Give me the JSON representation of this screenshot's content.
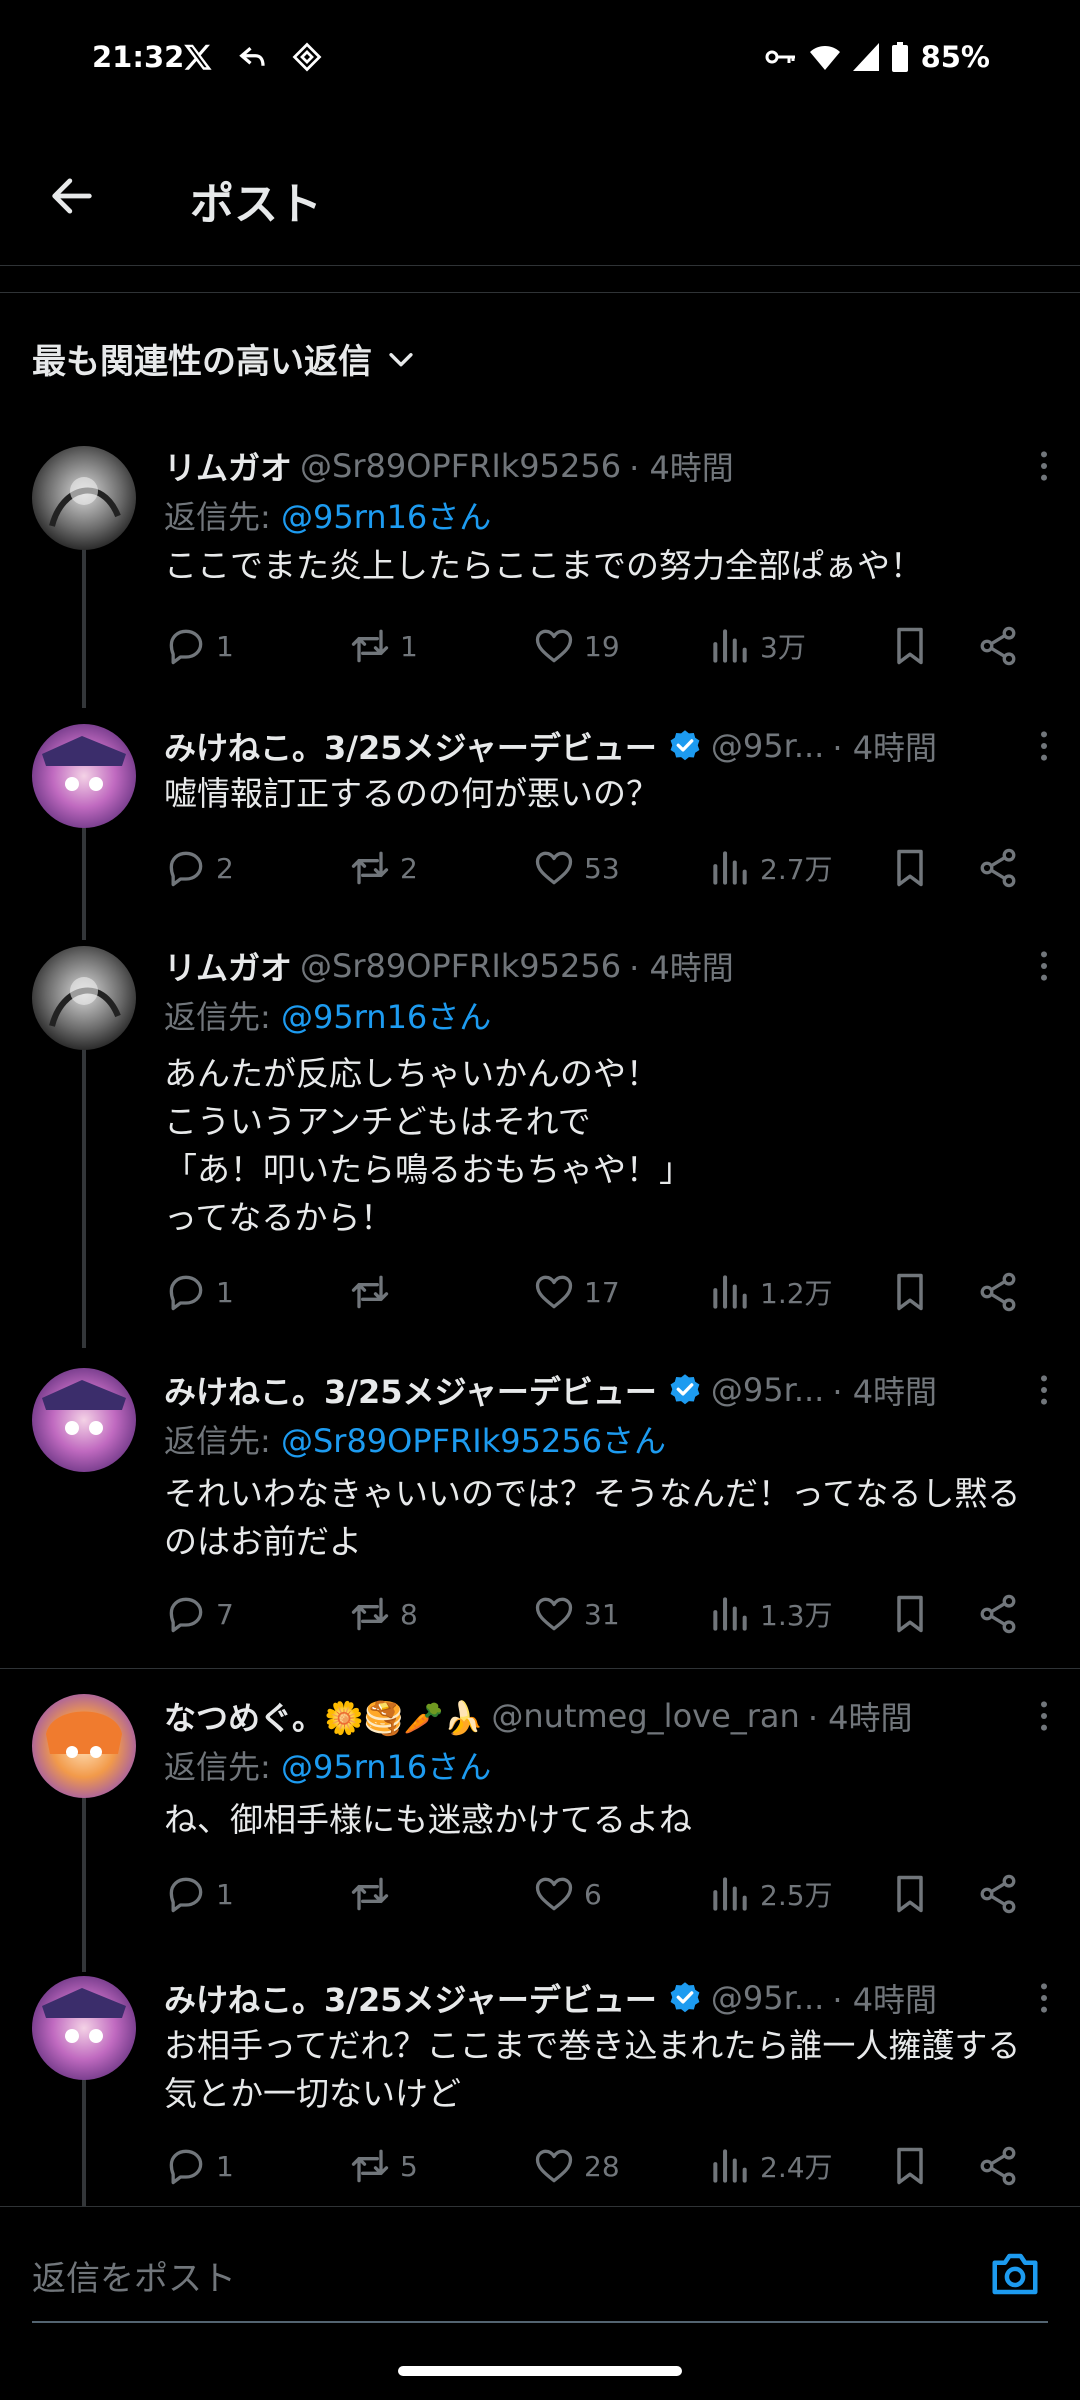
{
  "status_bar": {
    "time": "21:32",
    "battery": "85%",
    "icons": [
      "x-logo-icon",
      "reply-arrow-icon",
      "diamond-icon",
      "key-icon",
      "wifi-icon",
      "signal-icon",
      "battery-icon"
    ]
  },
  "header": {
    "title": "ポスト"
  },
  "sort": {
    "label": "最も関連性の高い返信"
  },
  "posts": [
    {
      "name": "リムガオ",
      "handle": "@Sr89OPFRIk95256",
      "time": "· 4時間",
      "reply_prefix": "返信先: ",
      "reply_to": "@95rn16さん",
      "text": "ここでまた炎上したらここまでの努力全部ぱぁや！",
      "replies": "1",
      "reposts": "1",
      "likes": "19",
      "views": "3万"
    },
    {
      "name": "みけねこ。3/25メジャーデビュー",
      "handle": "@95r...",
      "time": "· 4時間",
      "text": "嘘情報訂正するのの何が悪いの？",
      "replies": "2",
      "reposts": "2",
      "likes": "53",
      "views": "2.7万"
    },
    {
      "name": "リムガオ",
      "handle": "@Sr89OPFRIk95256",
      "time": "· 4時間",
      "reply_prefix": "返信先: ",
      "reply_to": "@95rn16さん",
      "text": "あんたが反応しちゃいかんのや！\nこういうアンチどもはそれで\n「あ！叩いたら鳴るおもちゃや！」\nってなるから！",
      "replies": "1",
      "reposts": "",
      "likes": "17",
      "views": "1.2万"
    },
    {
      "name": "みけねこ。3/25メジャーデビュー",
      "handle": "@95r...",
      "time": "· 4時間",
      "reply_prefix": "返信先: ",
      "reply_to": "@Sr89OPFRIk95256さん",
      "text": "それいわなきゃいいのでは？そうなんだ！ってなるし黙るのはお前だよ",
      "replies": "7",
      "reposts": "8",
      "likes": "31",
      "views": "1.3万"
    },
    {
      "name": "なつめぐ。🌼🥞🥕🍌",
      "handle": "@nutmeg_love_ran",
      "time": "· 4時間",
      "reply_prefix": "返信先: ",
      "reply_to": "@95rn16さん",
      "text": "ね、御相手様にも迷惑かけてるよね",
      "replies": "1",
      "reposts": "",
      "likes": "6",
      "views": "2.5万"
    },
    {
      "name": "みけねこ。3/25メジャーデビュー",
      "handle": "@95r...",
      "time": "· 4時間",
      "text": "お相手ってだれ？ここまで巻き込まれたら誰一人擁護する気とか一切ないけど",
      "replies": "1",
      "reposts": "5",
      "likes": "28",
      "views": "2.4万"
    }
  ],
  "reply_bar": {
    "placeholder": "返信をポスト"
  },
  "colors": {
    "accent": "#1d9bf0",
    "muted": "#71767b",
    "text": "#e7e9ea",
    "background": "#000000"
  }
}
